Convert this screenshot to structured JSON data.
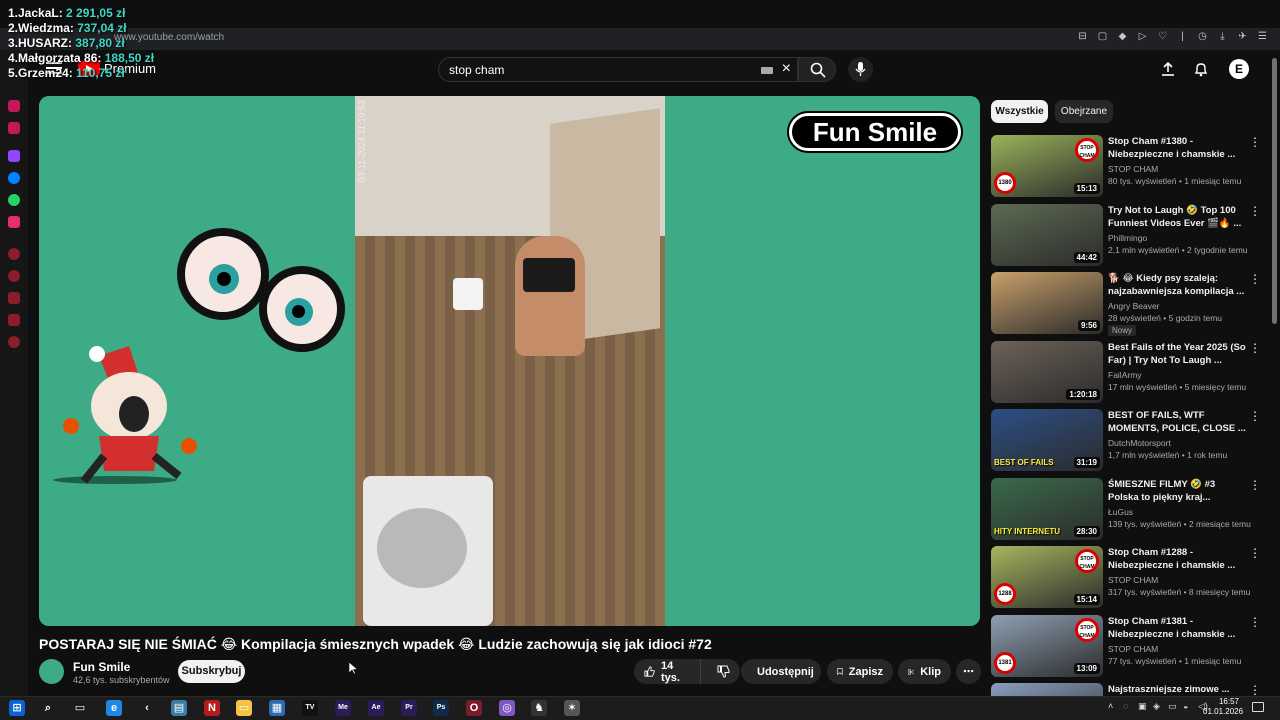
{
  "overlay": {
    "donors": [
      {
        "name": "1.JackaL:",
        "amount": "2 291,05 zł"
      },
      {
        "name": "2.Wiedzma:",
        "amount": "737,04 zł"
      },
      {
        "name": "3.HUSARZ:",
        "amount": "387,80 zł"
      },
      {
        "name": "4.Małgorzata 86:",
        "amount": "188,50 zł"
      },
      {
        "name": "5.Grzem24:",
        "amount": "110,75 zł"
      }
    ]
  },
  "browser": {
    "url": "www.youtube.com/watch"
  },
  "header": {
    "logo_text": "Premium",
    "search_value": "stop cham",
    "avatar_letter": "E"
  },
  "player": {
    "overlay_badge": "Fun Smile",
    "timestamp": "03-11-2024 11:19:53"
  },
  "video": {
    "title": "POSTARAJ SIĘ NIE ŚMIAĆ 😂 Kompilacja śmiesznych wpadek 😂 Ludzie zachowują się jak idioci #72",
    "channel_name": "Fun Smile",
    "channel_subs": "42,6 tys. subskrybentów",
    "subscribe_label": "Subskrybuj",
    "likes": "14 tys.",
    "share_label": "Udostępnij",
    "save_label": "Zapisz",
    "clip_label": "Klip"
  },
  "chips": {
    "all": "Wszystkie",
    "watched": "Obejrzane"
  },
  "recommendations": [
    {
      "title": "Stop Cham #1380 - Niebezpieczne i chamskie ...",
      "channel": "STOP CHAM",
      "meta": "80 tys. wyświetleń • 1 miesiąc temu",
      "duration": "15:13",
      "episode": "1380",
      "thumb_color": "#9bb35a"
    },
    {
      "title": "Try Not to Laugh 🤣 Top 100 Funniest Videos Ever 🎬🔥 ...",
      "channel": "Phillmingo",
      "meta": "2,1 mln wyświetleń • 2 tygodnie temu",
      "duration": "44:42",
      "thumb_color": "#5d6b52"
    },
    {
      "title": "🐕 😂 Kiedy psy szaleją: najzabawniejsza kompilacja ...",
      "channel": "Angry Beaver",
      "meta": "28 wyświetleń • 5 godzin temu",
      "duration": "9:56",
      "badge": "Nowy",
      "thumb_color": "#c9a06a"
    },
    {
      "title": "Best Fails of the Year 2025 (So Far) | Try Not To Laugh ...",
      "channel": "FailArmy",
      "meta": "17 mln wyświetleń • 5 miesięcy temu",
      "duration": "1:20:18",
      "thumb_color": "#6c6258"
    },
    {
      "title": "BEST OF FAILS, WTF MOMENTS, POLICE, CLOSE ...",
      "channel": "DutchMotorsport",
      "meta": "1,7 mln wyświetleń • 1 rok temu",
      "duration": "31:19",
      "thumb_label": "BEST OF FAILS",
      "thumb_color": "#2c4f86"
    },
    {
      "title": "ŚMIESZNE FILMY 🤣 #3 Polska to piękny kraj... 🔴ŁuGus 😂T...",
      "channel": "ŁuGus",
      "meta": "139 tys. wyświetleń • 2 miesiące temu",
      "duration": "28:30",
      "thumb_label": "HITY INTERNETU",
      "thumb_color": "#3a6a4a"
    },
    {
      "title": "Stop Cham #1288 - Niebezpieczne i chamskie ...",
      "channel": "STOP CHAM",
      "meta": "317 tys. wyświetleń • 8 miesięcy temu",
      "duration": "15:14",
      "episode": "1288",
      "thumb_color": "#a7b65e"
    },
    {
      "title": "Stop Cham #1381 - Niebezpieczne i chamskie ...",
      "channel": "STOP CHAM",
      "meta": "77 tys. wyświetleń • 1 miesiąc temu",
      "duration": "13:09",
      "episode": "1381",
      "thumb_color": "#8fa0b3"
    },
    {
      "title": "Najstraszniejsze zimowe ...",
      "channel": "",
      "meta": "",
      "duration": "",
      "thumb_color": "#8aa0c0"
    }
  ],
  "taskbar": {
    "time": "16:57",
    "date": "01.01.2026",
    "apps": [
      "start",
      "search",
      "task-view",
      "edge",
      "back",
      "store-box",
      "netflix",
      "explorer",
      "ms-store",
      "tradingview",
      "Me",
      "Ae",
      "Pr",
      "Ps",
      "opera",
      "messenger",
      "chess",
      "wolf"
    ]
  },
  "colors": {
    "accent": "#3eab87",
    "youtube_red": "#ff0000",
    "donor_amount": "#3fd8c8"
  }
}
